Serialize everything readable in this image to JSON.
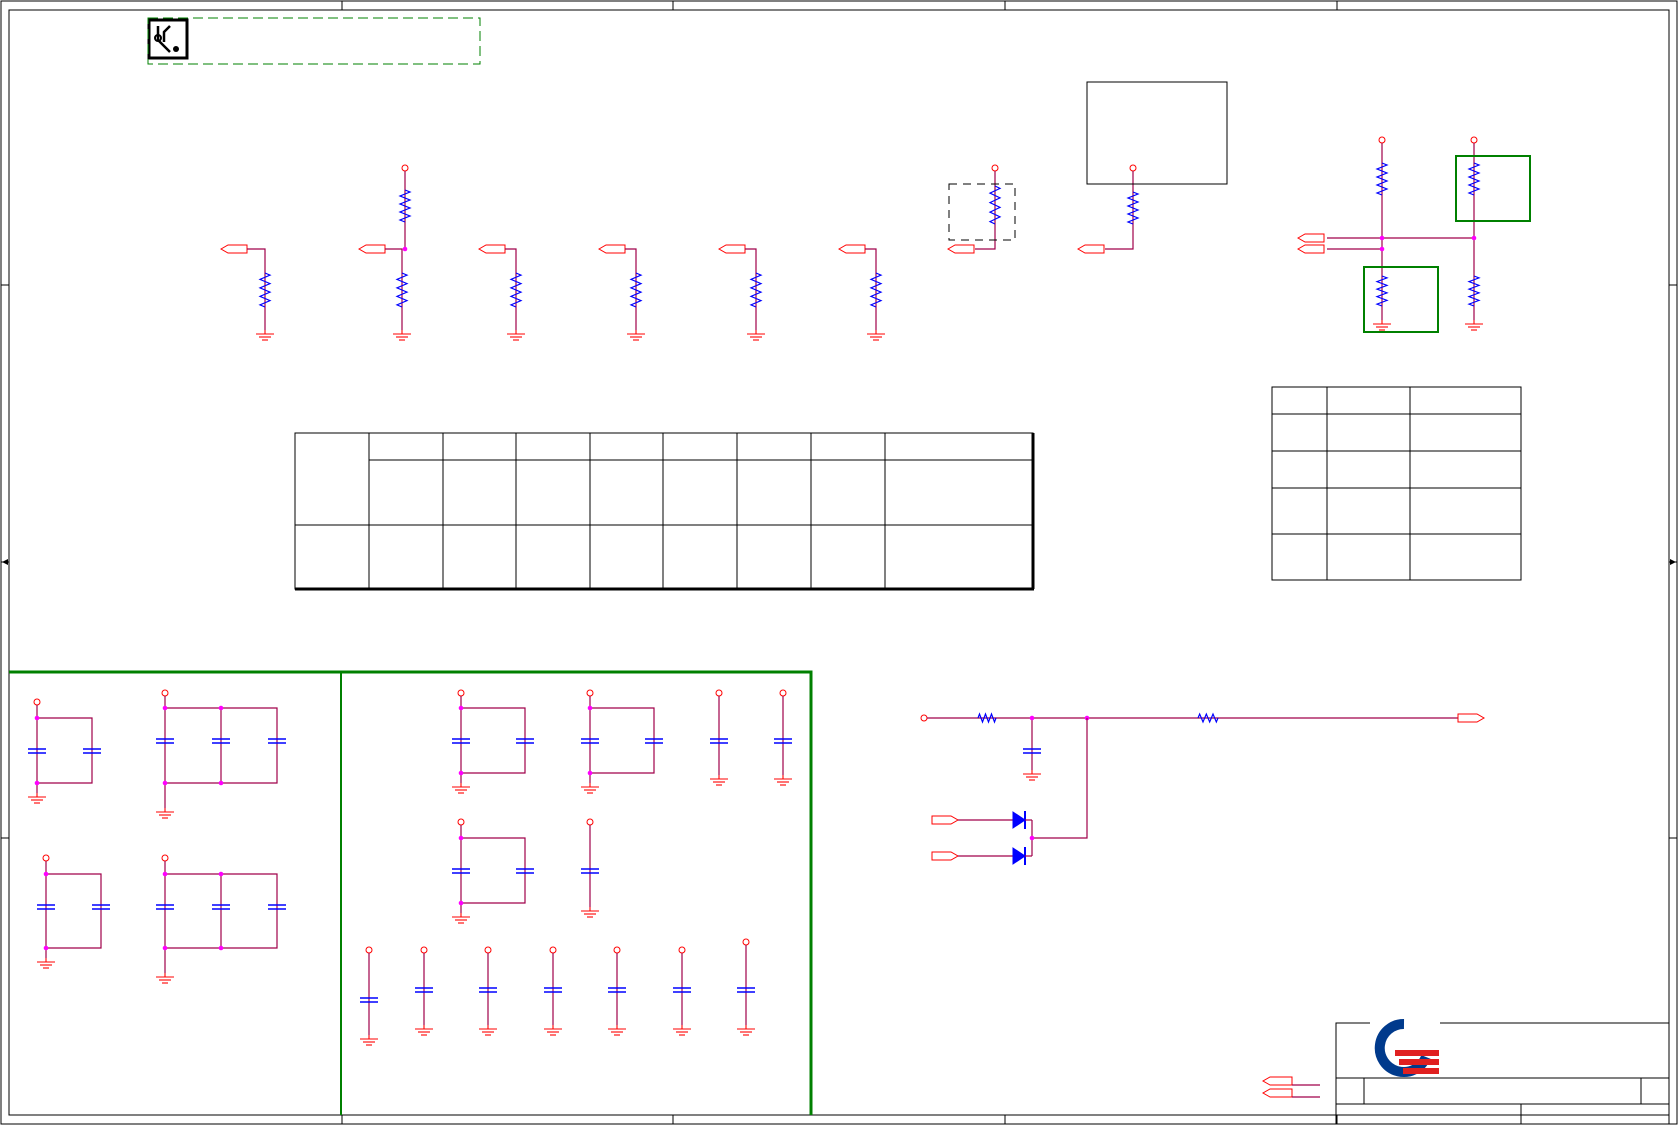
{
  "sheet": {
    "border_zones_top": [
      "",
      "",
      "",
      "",
      ""
    ],
    "title_block": {
      "company": "",
      "title": "",
      "doc_number": "",
      "rev": "",
      "sheet": ""
    },
    "colors": {
      "wire": "#a0004a",
      "resistor": "#0000ff",
      "power_port": "#ff0000",
      "junction": "#ff00ff",
      "highlight_box": "#008000",
      "logo_blue": "#003a8c",
      "logo_red": "#e02020"
    }
  },
  "icons": {
    "pcb_logo": "circuit-board-icon",
    "company_logo": "quanta-logo-icon"
  },
  "strap_table": {
    "header_cells": [
      "",
      "",
      "",
      "",
      "",
      "",
      "",
      ""
    ],
    "row1": [
      "",
      "",
      "",
      "",
      "",
      "",
      "",
      ""
    ],
    "row2": [
      "",
      "",
      "",
      "",
      "",
      "",
      "",
      ""
    ]
  },
  "small_table": {
    "rows": [
      [
        "",
        "",
        ""
      ],
      [
        "",
        "",
        ""
      ],
      [
        "",
        "",
        ""
      ],
      [
        "",
        "",
        ""
      ],
      [
        "",
        "",
        ""
      ]
    ]
  }
}
